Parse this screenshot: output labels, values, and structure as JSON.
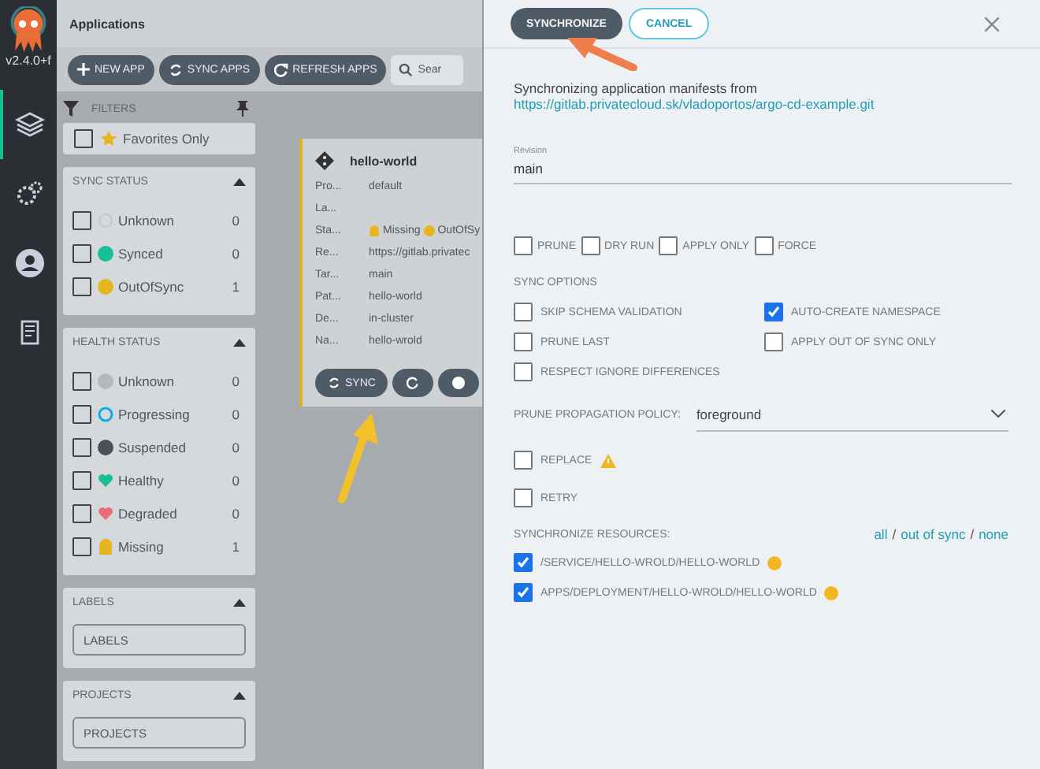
{
  "rail": {
    "version": "v2.4.0+f",
    "items": [
      {
        "kind": "layers",
        "selected": true
      },
      {
        "kind": "gears",
        "selected": false
      },
      {
        "kind": "user",
        "selected": false
      },
      {
        "kind": "docs",
        "selected": false
      }
    ]
  },
  "header": {
    "title": "Applications"
  },
  "toolbar": {
    "buttons": [
      {
        "kind": "plus",
        "label": "NEW APP"
      },
      {
        "kind": "sync",
        "label": "SYNC APPS"
      },
      {
        "kind": "refresh",
        "label": "REFRESH APPS"
      }
    ],
    "search": {
      "placeholder": "Sear"
    }
  },
  "filters": {
    "title": "FILTERS",
    "favorites": {
      "label": "Favorites Only",
      "checked": false
    },
    "sync_status": {
      "title": "SYNC STATUS",
      "items": [
        {
          "kind": "unknown",
          "label": "Unknown",
          "count": "0",
          "checked": false
        },
        {
          "kind": "synced",
          "label": "Synced",
          "count": "0",
          "checked": false
        },
        {
          "kind": "outofsync",
          "label": "OutOfSync",
          "count": "1",
          "checked": false
        }
      ]
    },
    "health_status": {
      "title": "HEALTH STATUS",
      "items": [
        {
          "kind": "unknown2",
          "label": "Unknown",
          "count": "0",
          "checked": false
        },
        {
          "kind": "progressing",
          "label": "Progressing",
          "count": "0",
          "checked": false
        },
        {
          "kind": "suspended",
          "label": "Suspended",
          "count": "0",
          "checked": false
        },
        {
          "kind": "healthy",
          "label": "Healthy",
          "count": "0",
          "checked": false
        },
        {
          "kind": "degraded",
          "label": "Degraded",
          "count": "0",
          "checked": false
        },
        {
          "kind": "missing",
          "label": "Missing",
          "count": "1",
          "checked": false
        }
      ]
    },
    "labels": {
      "title": "LABELS",
      "placeholder": "LABELS"
    },
    "projects": {
      "title": "PROJECTS",
      "placeholder": "PROJECTS"
    }
  },
  "card": {
    "name": "hello-world",
    "fields": [
      {
        "label": "Pro...",
        "value": "default"
      },
      {
        "label": "La..."
      },
      {
        "label": "Sta...",
        "statuses": [
          {
            "kind": "missing",
            "text": "Missing"
          },
          {
            "kind": "outofsync",
            "text": "OutOfSy"
          }
        ]
      },
      {
        "label": "Re...",
        "value": "https://gitlab.privatec"
      },
      {
        "label": "Tar...",
        "value": "main"
      },
      {
        "label": "Pat...",
        "value": "hello-world"
      },
      {
        "label": "De...",
        "value": "in-cluster"
      },
      {
        "label": "Na...",
        "value": "hello-wrold"
      }
    ],
    "sync_button": "SYNC"
  },
  "panel": {
    "synchronize": "SYNCHRONIZE",
    "cancel": "CANCEL",
    "intro": "Synchronizing application manifests from",
    "repo_link": "https://gitlab.privatecloud.sk/vladoportos/argo-cd-example.git",
    "revision": {
      "label": "Revision",
      "value": "main"
    },
    "options": [
      {
        "label": "PRUNE",
        "checked": false
      },
      {
        "label": "DRY RUN",
        "checked": false
      },
      {
        "label": "APPLY ONLY",
        "checked": false
      },
      {
        "label": "FORCE",
        "checked": false
      }
    ],
    "sync_options_title": "SYNC OPTIONS",
    "sync_options": [
      {
        "label": "SKIP SCHEMA VALIDATION",
        "checked": false
      },
      {
        "label": "AUTO-CREATE NAMESPACE",
        "checked": true
      },
      {
        "label": "PRUNE LAST",
        "checked": false
      },
      {
        "label": "APPLY OUT OF SYNC ONLY",
        "checked": false
      },
      {
        "label": "RESPECT IGNORE DIFFERENCES",
        "checked": false
      }
    ],
    "prune_policy": {
      "label": "PRUNE PROPAGATION POLICY:",
      "value": "foreground"
    },
    "replace": {
      "label": "REPLACE",
      "checked": false
    },
    "retry": {
      "label": "RETRY",
      "checked": false
    },
    "resources_title": "SYNCHRONIZE RESOURCES:",
    "resource_links": [
      "all",
      "out of sync",
      "none"
    ],
    "link_separator": "/",
    "resources": [
      {
        "label": "/SERVICE/HELLO-WROLD/HELLO-WORLD",
        "checked": true
      },
      {
        "label": "APPS/DEPLOYMENT/HELLO-WROLD/HELLO-WORLD",
        "checked": true
      }
    ]
  }
}
